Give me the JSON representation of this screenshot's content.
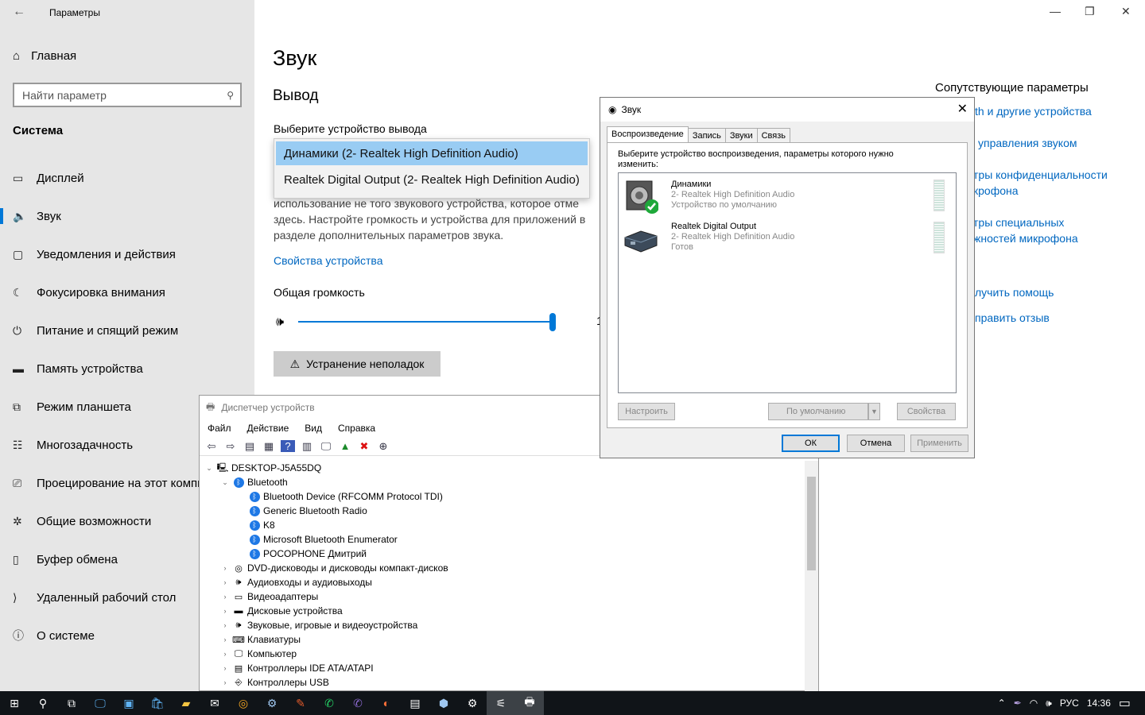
{
  "settings": {
    "app_title": "Параметры",
    "back_icon": "back-arrow-icon",
    "home_label": "Главная",
    "search_placeholder": "Найти параметр",
    "section": "Система",
    "nav": [
      {
        "label": "Дисплей",
        "icon": "display-icon"
      },
      {
        "label": "Звук",
        "icon": "speaker-icon",
        "active": true
      },
      {
        "label": "Уведомления и действия",
        "icon": "notification-icon"
      },
      {
        "label": "Фокусировка внимания",
        "icon": "moon-icon"
      },
      {
        "label": "Питание и спящий режим",
        "icon": "power-icon"
      },
      {
        "label": "Память устройства",
        "icon": "storage-icon"
      },
      {
        "label": "Режим планшета",
        "icon": "tablet-icon"
      },
      {
        "label": "Многозадачность",
        "icon": "multitask-icon"
      },
      {
        "label": "Проецирование на этот компьютер",
        "icon": "project-icon"
      },
      {
        "label": "Общие возможности",
        "icon": "shared-icon"
      },
      {
        "label": "Буфер обмена",
        "icon": "clipboard-icon"
      },
      {
        "label": "Удаленный рабочий стол",
        "icon": "remote-icon"
      },
      {
        "label": "О системе",
        "icon": "info-icon"
      }
    ],
    "page_title": "Звук",
    "output_title": "Вывод",
    "choose_label": "Выберите устройство вывода",
    "dropdown_options": [
      "Динамики (2- Realtek High Definition Audio)",
      "Realtek Digital Output (2- Realtek High Definition Audio)"
    ],
    "warn_line1": "использование не того звукового устройства, которое отме",
    "warn_line2": "здесь. Настройте громкость и устройства для приложений в",
    "warn_line3": "разделе дополнительных параметров звука.",
    "device_props_link": "Свойства устройства",
    "volume_label": "Общая громкость",
    "volume_level": 1.0,
    "volume_value_partial": "1",
    "troubleshoot": "Устранение неполадок",
    "related_heading": "Сопутствующие параметры",
    "related_links": [
      "th и другие устройства",
      "управления звуком",
      "тры конфиденциальности",
      "крофона",
      "тры специальных",
      "жностей микрофона",
      "лучить помощь",
      "править отзыв"
    ]
  },
  "devmgr": {
    "title": "Диспетчер устройств",
    "menu": [
      "Файл",
      "Действие",
      "Вид",
      "Справка"
    ],
    "tree": [
      {
        "level": 0,
        "exp": "⌄",
        "icon": "computer-icon",
        "label": "DESKTOP-J5A55DQ"
      },
      {
        "level": 1,
        "exp": "⌄",
        "icon": "bluetooth-icon",
        "label": "Bluetooth"
      },
      {
        "level": 2,
        "exp": "",
        "icon": "bluetooth-icon",
        "label": "Bluetooth Device (RFCOMM Protocol TDI)"
      },
      {
        "level": 2,
        "exp": "",
        "icon": "bluetooth-icon",
        "label": "Generic Bluetooth Radio"
      },
      {
        "level": 2,
        "exp": "",
        "icon": "bluetooth-icon",
        "label": "K8"
      },
      {
        "level": 2,
        "exp": "",
        "icon": "bluetooth-icon",
        "label": "Microsoft Bluetooth Enumerator"
      },
      {
        "level": 2,
        "exp": "",
        "icon": "bluetooth-icon",
        "label": "POCOPHONE Дмитрий"
      },
      {
        "level": 1,
        "exp": "›",
        "icon": "dvd-icon",
        "label": "DVD-дисководы и дисководы компакт-дисков"
      },
      {
        "level": 1,
        "exp": "›",
        "icon": "audio-io-icon",
        "label": "Аудиовходы и аудиовыходы"
      },
      {
        "level": 1,
        "exp": "›",
        "icon": "display-adapter-icon",
        "label": "Видеоадаптеры"
      },
      {
        "level": 1,
        "exp": "›",
        "icon": "disk-icon",
        "label": "Дисковые устройства"
      },
      {
        "level": 1,
        "exp": "›",
        "icon": "sound-device-icon",
        "label": "Звуковые, игровые и видеоустройства"
      },
      {
        "level": 1,
        "exp": "›",
        "icon": "keyboard-icon",
        "label": "Клавиатуры"
      },
      {
        "level": 1,
        "exp": "›",
        "icon": "monitor-icon",
        "label": "Компьютер"
      },
      {
        "level": 1,
        "exp": "›",
        "icon": "ide-icon",
        "label": "Контроллеры IDE ATA/ATAPI"
      },
      {
        "level": 1,
        "exp": "›",
        "icon": "usb-icon",
        "label": "Контроллеры USB"
      }
    ]
  },
  "sound": {
    "title": "Звук",
    "tabs": [
      "Воспроизведение",
      "Запись",
      "Звуки",
      "Связь"
    ],
    "instruction": "Выберите устройство воспроизведения, параметры которого нужно изменить:",
    "devices": [
      {
        "name": "Динамики",
        "line2": "2- Realtek High Definition Audio",
        "line3": "Устройство по умолчанию",
        "icon": "speaker-default-icon"
      },
      {
        "name": "Realtek Digital Output",
        "line2": "2- Realtek High Definition Audio",
        "line3": "Готов",
        "icon": "digital-output-icon"
      }
    ],
    "btn_configure": "Настроить",
    "btn_default": "По умолчанию",
    "btn_props": "Свойства",
    "btn_ok": "ОК",
    "btn_cancel": "Отмена",
    "btn_apply": "Применить"
  },
  "taskbar": {
    "lang": "РУС",
    "time": "14:36"
  }
}
